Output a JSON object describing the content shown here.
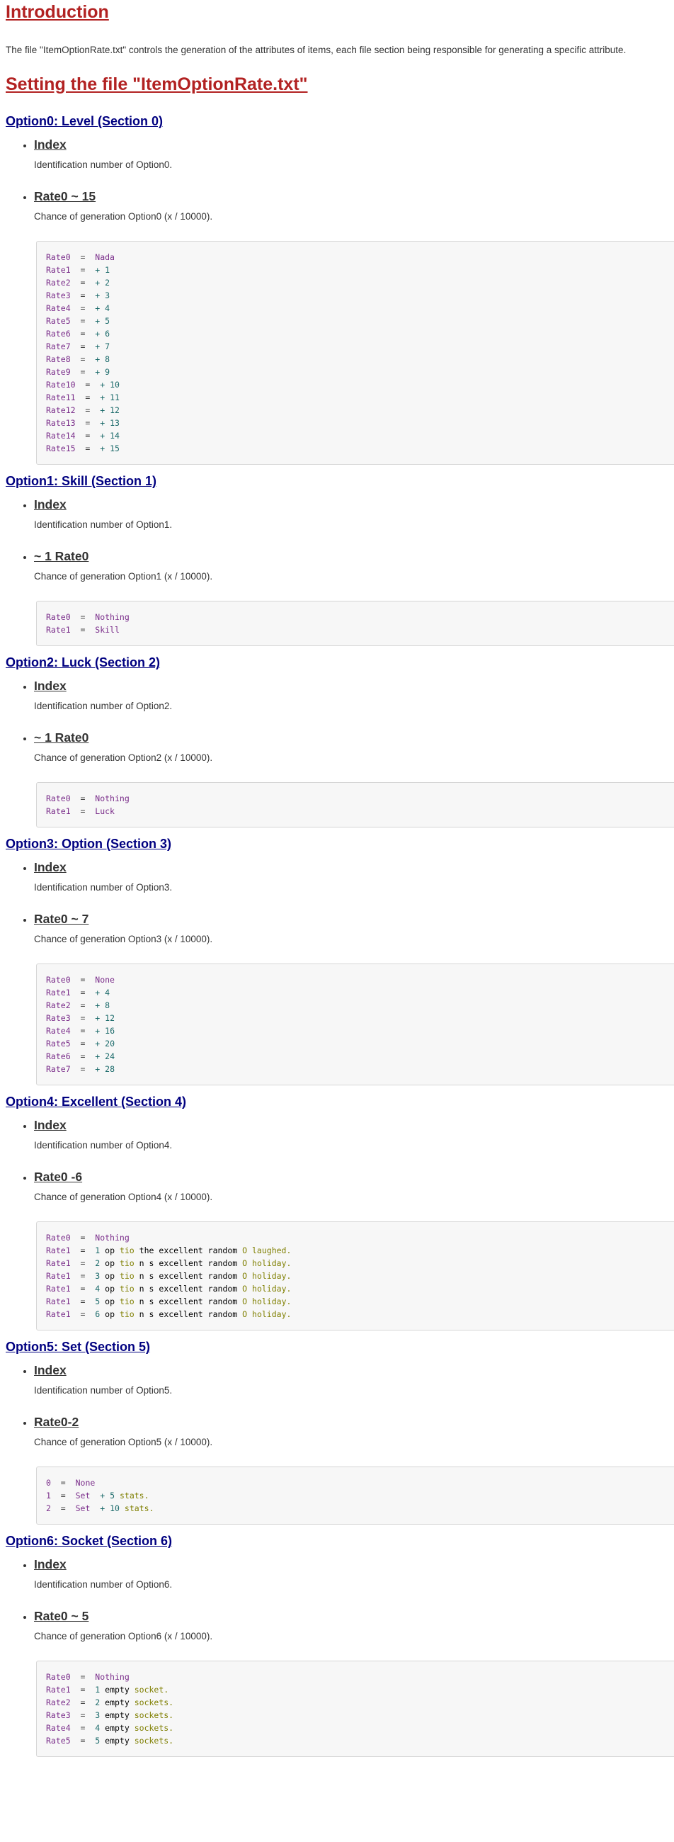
{
  "intro": {
    "heading": "Introduction",
    "text": "The file \"ItemOptionRate.txt\" controls the generation of the attributes of items, each file section being responsible for generating a specific attribute."
  },
  "setting_heading": "Setting the file \"ItemOptionRate.txt\"",
  "sections": [
    {
      "title": "Option0: Level (Section 0)",
      "index_label": "Index",
      "index_desc": "Identification number of Option0.",
      "rate_label": "Rate0 ~ 15",
      "rate_desc": "Chance of generation Option0 (x / 10000).",
      "code": [
        [
          "Rate0",
          "=",
          "Nada"
        ],
        [
          "Rate1",
          "=",
          "+ 1"
        ],
        [
          "Rate2",
          "=",
          "+ 2"
        ],
        [
          "Rate3",
          "=",
          "+ 3"
        ],
        [
          "Rate4",
          "=",
          "+ 4"
        ],
        [
          "Rate5",
          "=",
          "+ 5"
        ],
        [
          "Rate6",
          "=",
          "+ 6"
        ],
        [
          "Rate7",
          "=",
          "+ 7"
        ],
        [
          "Rate8",
          "=",
          "+ 8"
        ],
        [
          "Rate9",
          "=",
          "+ 9"
        ],
        [
          "Rate10",
          "=",
          "+ 10"
        ],
        [
          "Rate11",
          "=",
          "+ 11"
        ],
        [
          "Rate12",
          "=",
          "+ 12"
        ],
        [
          "Rate13",
          "=",
          "+ 13"
        ],
        [
          "Rate14",
          "=",
          "+ 14"
        ],
        [
          "Rate15",
          "=",
          "+ 15"
        ]
      ]
    },
    {
      "title": "Option1: Skill (Section 1)",
      "index_label": "Index",
      "index_desc": "Identification number of Option1.",
      "rate_label": "~ 1 Rate0",
      "rate_desc": "Chance of generation Option1 (x / 10000).",
      "code": [
        [
          "Rate0",
          "=",
          "Nothing"
        ],
        [
          "Rate1",
          "=",
          "Skill"
        ]
      ]
    },
    {
      "title": "Option2: Luck (Section 2)",
      "index_label": "Index",
      "index_desc": "Identification number of Option2.",
      "rate_label": "~ 1 Rate0",
      "rate_desc": "Chance of generation Option2 (x / 10000).",
      "code": [
        [
          "Rate0",
          "=",
          "Nothing"
        ],
        [
          "Rate1",
          "=",
          "Luck"
        ]
      ]
    },
    {
      "title": "Option3: Option (Section 3)",
      "index_label": "Index",
      "index_desc": "Identification number of Option3.",
      "rate_label": "Rate0 ~ 7",
      "rate_desc": "Chance of generation Option3 (x / 10000).",
      "code": [
        [
          "Rate0",
          "=",
          "None"
        ],
        [
          "Rate1",
          "=",
          "+ 4"
        ],
        [
          "Rate2",
          "=",
          "+ 8"
        ],
        [
          "Rate3",
          "=",
          "+ 12"
        ],
        [
          "Rate4",
          "=",
          "+ 16"
        ],
        [
          "Rate5",
          "=",
          "+ 20"
        ],
        [
          "Rate6",
          "=",
          "+ 24"
        ],
        [
          "Rate7",
          "=",
          "+ 28"
        ]
      ]
    },
    {
      "title": "Option4: Excellent (Section 4)",
      "index_label": "Index",
      "index_desc": "Identification number of Option4.",
      "rate_label": "Rate0 -6",
      "rate_desc": "Chance of generation Option4 (x / 10000).",
      "code": [
        [
          "Rate0",
          "=",
          "Nothing"
        ],
        [
          "Rate1",
          "=",
          "1 op tio the excellent random O laughed."
        ],
        [
          "Rate1",
          "=",
          "2 op tio n s excellent random O holiday."
        ],
        [
          "Rate1",
          "=",
          "3 op tio n s excellent random O holiday."
        ],
        [
          "Rate1",
          "=",
          "4 op tio n s excellent random O holiday."
        ],
        [
          "Rate1",
          "=",
          "5 op tio n s excellent random O holiday."
        ],
        [
          "Rate1",
          "=",
          "6 op tio n s excellent random O holiday."
        ]
      ]
    },
    {
      "title": "Option5: Set (Section 5)",
      "index_label": "Index",
      "index_desc": "Identification number of Option5.",
      "rate_label": "Rate0-2",
      "rate_desc": "Chance of generation Option5 (x / 10000).",
      "code": [
        [
          "0",
          "=",
          "None"
        ],
        [
          "1",
          "=",
          "Set  + 5 stats."
        ],
        [
          "2",
          "=",
          "Set  + 10 stats."
        ]
      ]
    },
    {
      "title": "Option6: Socket (Section 6)",
      "index_label": "Index",
      "index_desc": "Identification number of Option6.",
      "rate_label": "Rate0 ~ 5",
      "rate_desc": "Chance of generation Option6 (x / 10000).",
      "code": [
        [
          "Rate0",
          "=",
          "Nothing"
        ],
        [
          "Rate1",
          "=",
          "1 empty socket."
        ],
        [
          "Rate2",
          "=",
          "2 empty sockets."
        ],
        [
          "Rate3",
          "=",
          "3 empty sockets."
        ],
        [
          "Rate4",
          "=",
          "4 empty sockets."
        ],
        [
          "Rate5",
          "=",
          "5 empty sockets."
        ]
      ]
    }
  ]
}
